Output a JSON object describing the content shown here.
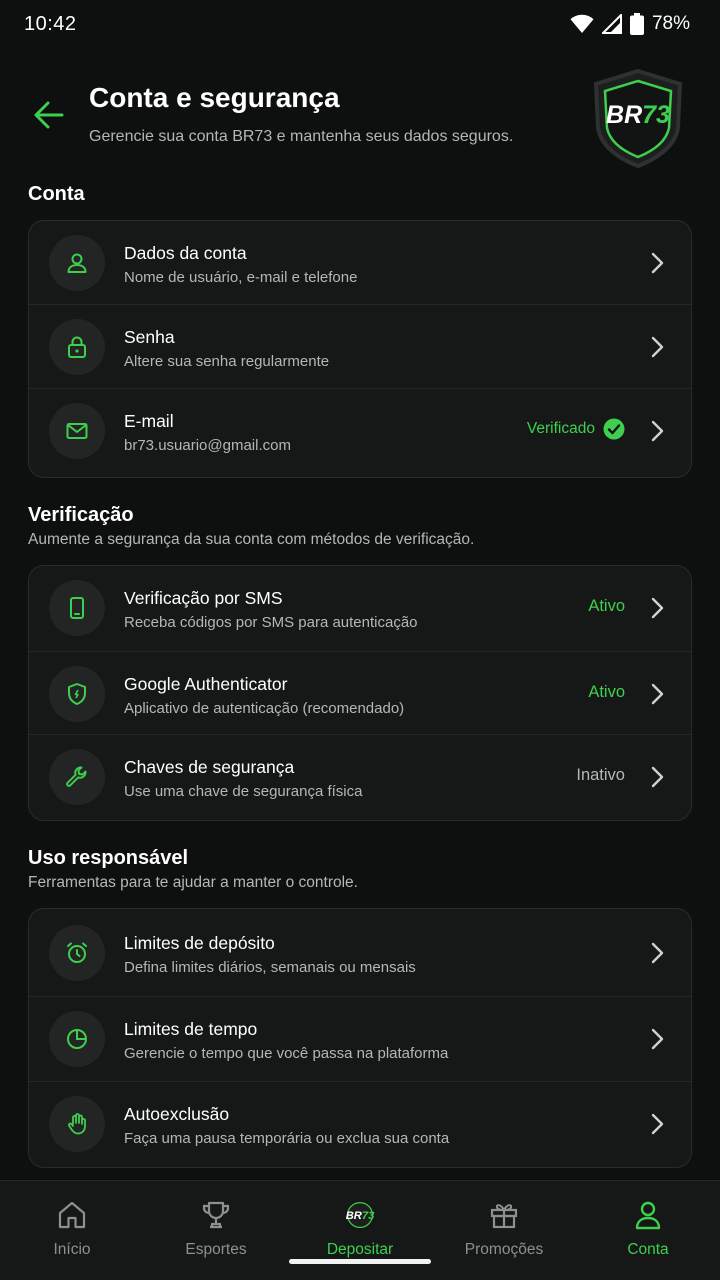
{
  "status_bar": {
    "time": "10:42",
    "battery": "78%"
  },
  "header": {
    "title": "Conta e segurança",
    "subtitle": "Gerencie sua conta BR73 e mantenha seus dados seguros.",
    "logo_text": "BR73"
  },
  "colors": {
    "accent": "#3ecf4f",
    "background": "#0e0f0f",
    "card": "#161817"
  },
  "conta": {
    "title": "Conta",
    "rows": [
      {
        "icon": "user-icon",
        "title": "Dados da conta",
        "sub": "Nome de usuário, e-mail e telefone"
      },
      {
        "icon": "lock-icon",
        "title": "Senha",
        "sub": "Altere sua senha regularmente"
      },
      {
        "icon": "mail-icon",
        "title": "E-mail",
        "sub": "br73.usuario@gmail.com",
        "status": "Verificado"
      }
    ]
  },
  "verificacao": {
    "title": "Verificação",
    "subtitle": "Aumente a segurança da sua conta com métodos de verificação.",
    "rows": [
      {
        "icon": "phone-icon",
        "title": "Verificação por SMS",
        "sub": "Receba códigos por SMS para autenticação",
        "status": "Ativo"
      },
      {
        "icon": "shield-icon",
        "title": "Google Authenticator",
        "sub": "Aplicativo de autenticação (recomendado)",
        "status": "Ativo"
      },
      {
        "icon": "wrench-icon",
        "title": "Chaves de segurança",
        "sub": "Use uma chave de segurança física",
        "status": "Inativo"
      }
    ]
  },
  "uso": {
    "title": "Uso responsável",
    "subtitle": "Ferramentas para te ajudar a manter o controle.",
    "rows": [
      {
        "icon": "alarm-icon",
        "title": "Limites de depósito",
        "sub": "Defina limites diários, semanais ou mensais"
      },
      {
        "icon": "pie-chart-icon",
        "title": "Limites de tempo",
        "sub": "Gerencie o tempo que você passa na plataforma"
      },
      {
        "icon": "hand-icon",
        "title": "Autoexclusão",
        "sub": "Faça uma pausa temporária ou exclua sua conta"
      }
    ]
  },
  "bottom_nav": [
    {
      "icon": "home-icon",
      "label": "Início"
    },
    {
      "icon": "trophy-icon",
      "label": "Esportes"
    },
    {
      "icon": "br73-logo-icon",
      "label": "Depositar",
      "logo_text": "BR73"
    },
    {
      "icon": "gift-icon",
      "label": "Promoções"
    },
    {
      "icon": "account-icon",
      "label": "Conta",
      "active": true
    }
  ]
}
